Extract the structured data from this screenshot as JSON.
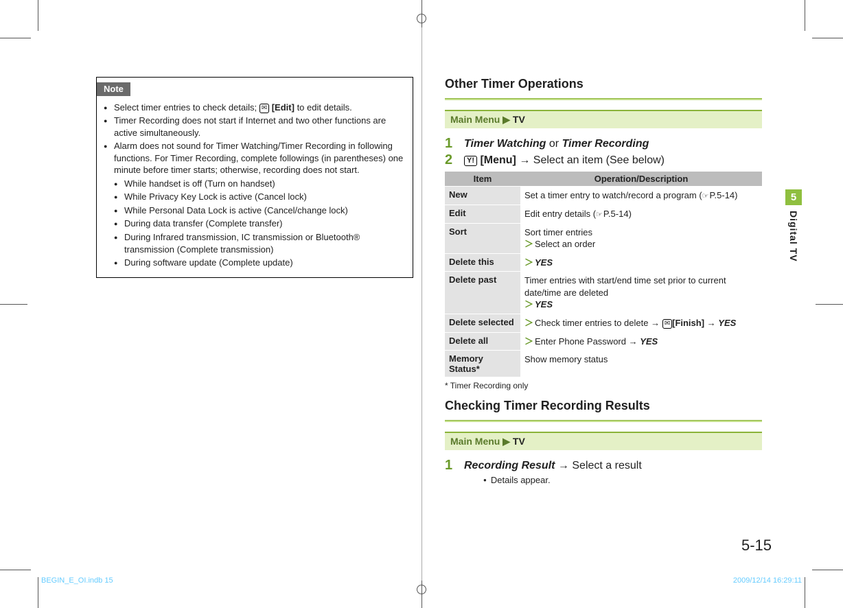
{
  "sidetab": {
    "num": "5",
    "label": "Digital TV"
  },
  "pagenum": "5-15",
  "footer": {
    "left": "BEGIN_E_OI.indb   15",
    "right": "2009/12/14   16:29:11"
  },
  "note": {
    "label": "Note",
    "edit_key": "✉",
    "edit_bracket": "[Edit]",
    "b1a": "Select timer entries to check details; ",
    "b1b": " to edit details.",
    "b2": "Timer Recording does not start if Internet and two other functions are active simultaneously.",
    "b3": "Alarm does not sound for Timer Watching/Timer Recording in following functions. For Timer Recording, complete followings (in parentheses) one minute before timer starts; otherwise, recording does not start.",
    "s": [
      "While handset is off (Turn on handset)",
      "While Privacy Key Lock is active (Cancel lock)",
      "While Personal Data Lock is active (Cancel/change lock)",
      "During data transfer (Complete transfer)",
      "During Infrared transmission, IC transmission or Bluetooth® transmission (Complete transmission)",
      "During software update (Complete update)"
    ]
  },
  "right": {
    "h1": "Other Timer Operations",
    "menu_prefix": "Main Menu ▶ ",
    "menu_item": "TV",
    "step1_a": "Timer Watching",
    "step1_mid": " or ",
    "step1_b": "Timer Recording",
    "step2_key": "Y!",
    "step2_menu": "[Menu]",
    "step2_arrow": " → ",
    "step2_tail": "Select an item (See below)",
    "thead": {
      "item": "Item",
      "op": "Operation/Description"
    },
    "rows": {
      "new": {
        "item": "New",
        "desc_a": "Set a timer entry to watch/record a program (",
        "ref": "P.5-14",
        "desc_b": ")"
      },
      "edit": {
        "item": "Edit",
        "desc_a": "Edit entry details (",
        "ref": "P.5-14",
        "desc_b": ")"
      },
      "sort": {
        "item": "Sort",
        "line1": "Sort timer entries",
        "line2": "Select an order"
      },
      "dthis": {
        "item": "Delete this",
        "yes": "YES"
      },
      "dpast": {
        "item": "Delete past",
        "line1": "Timer entries with start/end time set prior to current date/time are deleted",
        "yes": "YES"
      },
      "dsel": {
        "item": "Delete selected",
        "text": "Check timer entries to delete → ",
        "key": "✉",
        "finish": "[Finish]",
        "arrow": " → ",
        "yes": "YES"
      },
      "dall": {
        "item": "Delete all",
        "text": "Enter Phone Password → ",
        "yes": "YES"
      },
      "mem": {
        "item": "Memory Status*",
        "text": "Show memory status"
      }
    },
    "footnote": "* Timer Recording only",
    "h2": "Checking Timer Recording Results",
    "step3_a": "Recording Result",
    "step3_arrow": " → ",
    "step3_tail": "Select a result",
    "detail": "Details appear."
  }
}
